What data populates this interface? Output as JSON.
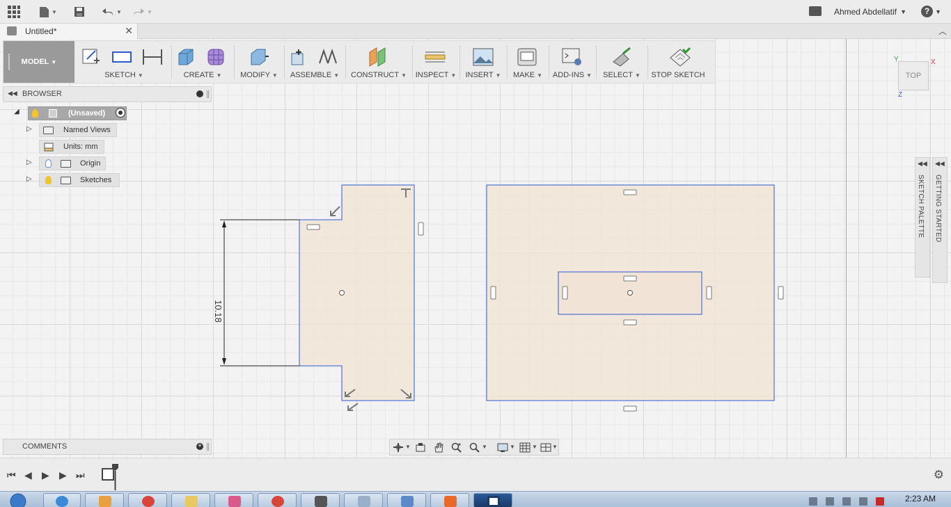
{
  "app": {
    "document_title": "Untitled*",
    "user_name": "Ahmed Abdellatif"
  },
  "toolbar": {
    "workspace": "MODEL",
    "groups": {
      "sketch": "SKETCH",
      "create": "CREATE",
      "modify": "MODIFY",
      "assemble": "ASSEMBLE",
      "construct": "CONSTRUCT",
      "inspect": "INSPECT",
      "insert": "INSERT",
      "make": "MAKE",
      "addins": "ADD-INS",
      "select": "SELECT",
      "stop_sketch": "STOP SKETCH"
    }
  },
  "browser": {
    "title": "BROWSER",
    "root": "(Unsaved)",
    "items": {
      "named_views": "Named Views",
      "units": "Units: mm",
      "origin": "Origin",
      "sketches": "Sketches"
    }
  },
  "comments": {
    "title": "COMMENTS"
  },
  "palettes": {
    "sketch_palette": "SKETCH PALETTE",
    "getting_started": "GETTING STARTED"
  },
  "viewcube": {
    "face": "TOP",
    "axis_x": "X",
    "axis_y": "Y",
    "axis_z": "Z"
  },
  "sketch": {
    "dimension_label": "10.18"
  },
  "colors": {
    "sketch_line": "#2b5ccf",
    "profile_fill": "#f1e4d6",
    "accent_model": "#9a9a9a",
    "green_axis": "#7ccb7c"
  },
  "taskbar": {
    "clock": "2:23 AM"
  }
}
